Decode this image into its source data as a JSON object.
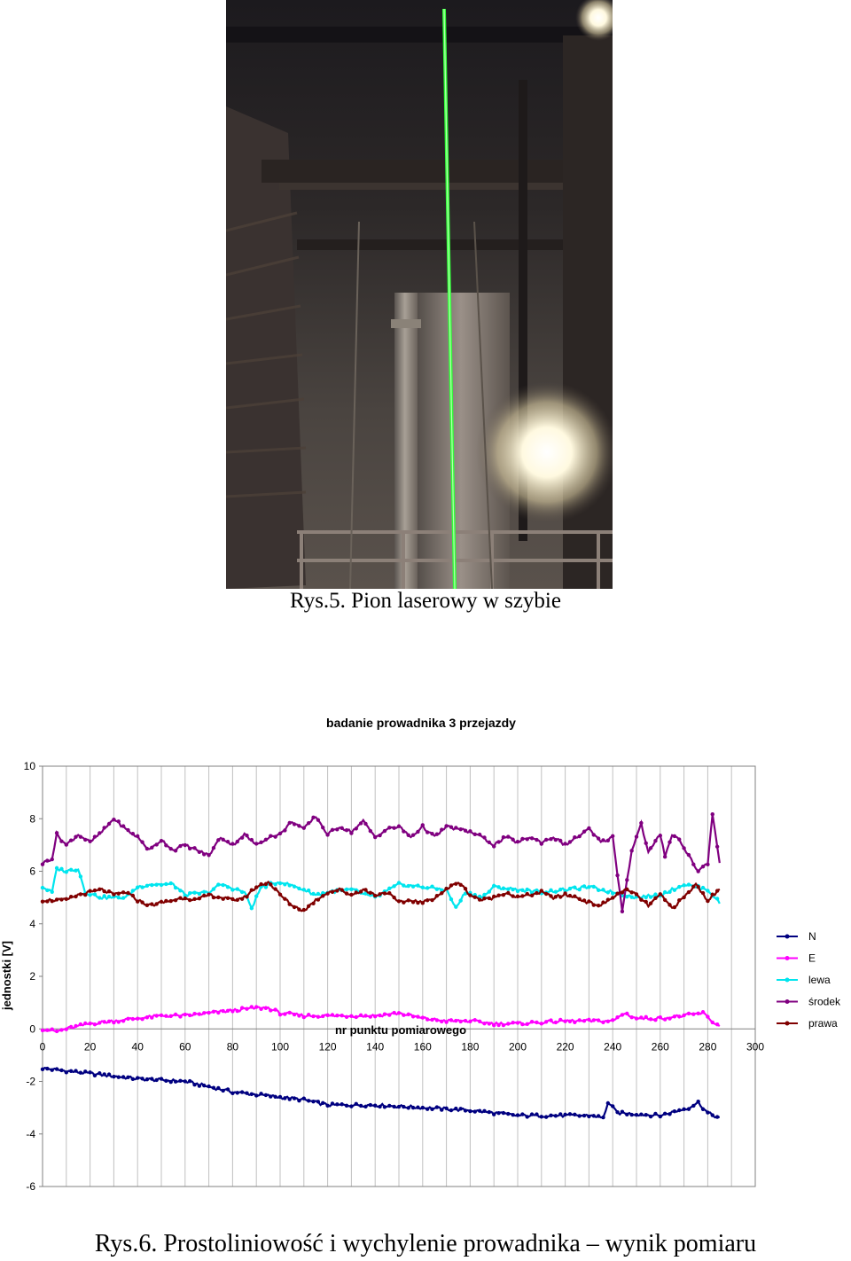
{
  "figure1": {
    "caption": "Rys.5. Pion laserowy w szybie",
    "image_description": "Dark mine shaft interior with a vertical green laser line"
  },
  "figure2": {
    "caption": "Rys.6. Prostoliniowość i wychylenie prowadnika – wynik pomiaru"
  },
  "colors": {
    "N": "#000080",
    "E": "#ff00ff",
    "lewa": "#00e5ee",
    "srodek": "#800080",
    "prawa": "#800000"
  },
  "chart_data": {
    "type": "line",
    "title": "badanie prowadnika 3 przejazdy",
    "xlabel": "nr punktu pomiarowego",
    "ylabel": "jednostki [V]",
    "xlim": [
      0,
      300
    ],
    "ylim": [
      -6,
      10
    ],
    "x_ticks": [
      0,
      20,
      40,
      60,
      80,
      100,
      120,
      140,
      160,
      180,
      200,
      220,
      240,
      260,
      280,
      300
    ],
    "y_ticks": [
      10,
      8,
      6,
      4,
      2,
      0,
      -2,
      -4,
      -6
    ],
    "grid": "vertical",
    "legend_position": "right",
    "x_points": [
      0,
      285
    ],
    "series": [
      {
        "name": "N",
        "key": "N",
        "anchors": [
          [
            0,
            -1.5
          ],
          [
            10,
            -1.6
          ],
          [
            20,
            -1.7
          ],
          [
            40,
            -1.9
          ],
          [
            60,
            -2.0
          ],
          [
            70,
            -2.2
          ],
          [
            80,
            -2.4
          ],
          [
            100,
            -2.6
          ],
          [
            110,
            -2.7
          ],
          [
            120,
            -2.9
          ],
          [
            140,
            -2.9
          ],
          [
            160,
            -3.0
          ],
          [
            180,
            -3.1
          ],
          [
            190,
            -3.2
          ],
          [
            200,
            -3.3
          ],
          [
            220,
            -3.3
          ],
          [
            232,
            -3.3
          ],
          [
            236,
            -3.4
          ],
          [
            238,
            -2.8
          ],
          [
            242,
            -3.2
          ],
          [
            260,
            -3.3
          ],
          [
            272,
            -3.0
          ],
          [
            276,
            -2.8
          ],
          [
            280,
            -3.2
          ],
          [
            285,
            -3.4
          ]
        ]
      },
      {
        "name": "E",
        "key": "E",
        "anchors": [
          [
            0,
            0.0
          ],
          [
            6,
            -0.1
          ],
          [
            10,
            0.0
          ],
          [
            20,
            0.2
          ],
          [
            30,
            0.3
          ],
          [
            40,
            0.4
          ],
          [
            50,
            0.5
          ],
          [
            60,
            0.5
          ],
          [
            70,
            0.6
          ],
          [
            80,
            0.7
          ],
          [
            90,
            0.8
          ],
          [
            95,
            0.8
          ],
          [
            100,
            0.6
          ],
          [
            110,
            0.5
          ],
          [
            120,
            0.5
          ],
          [
            140,
            0.5
          ],
          [
            150,
            0.6
          ],
          [
            160,
            0.4
          ],
          [
            170,
            0.3
          ],
          [
            180,
            0.3
          ],
          [
            190,
            0.2
          ],
          [
            200,
            0.2
          ],
          [
            220,
            0.3
          ],
          [
            240,
            0.3
          ],
          [
            245,
            0.6
          ],
          [
            250,
            0.4
          ],
          [
            260,
            0.4
          ],
          [
            270,
            0.5
          ],
          [
            278,
            0.6
          ],
          [
            283,
            0.2
          ],
          [
            285,
            0.1
          ]
        ]
      },
      {
        "name": "lewa",
        "key": "lewa",
        "anchors": [
          [
            0,
            5.4
          ],
          [
            4,
            5.2
          ],
          [
            6,
            6.1
          ],
          [
            10,
            6.0
          ],
          [
            15,
            6.1
          ],
          [
            18,
            5.2
          ],
          [
            25,
            5.0
          ],
          [
            35,
            5.0
          ],
          [
            40,
            5.4
          ],
          [
            45,
            5.5
          ],
          [
            55,
            5.5
          ],
          [
            60,
            5.1
          ],
          [
            70,
            5.2
          ],
          [
            75,
            5.5
          ],
          [
            85,
            5.2
          ],
          [
            88,
            4.6
          ],
          [
            92,
            5.4
          ],
          [
            100,
            5.6
          ],
          [
            110,
            5.3
          ],
          [
            115,
            5.1
          ],
          [
            120,
            5.2
          ],
          [
            130,
            5.3
          ],
          [
            140,
            5.0
          ],
          [
            150,
            5.5
          ],
          [
            160,
            5.4
          ],
          [
            170,
            5.3
          ],
          [
            174,
            4.6
          ],
          [
            178,
            5.2
          ],
          [
            185,
            5.0
          ],
          [
            190,
            5.4
          ],
          [
            200,
            5.3
          ],
          [
            210,
            5.2
          ],
          [
            220,
            5.3
          ],
          [
            230,
            5.4
          ],
          [
            240,
            5.2
          ],
          [
            250,
            5.0
          ],
          [
            260,
            5.1
          ],
          [
            270,
            5.5
          ],
          [
            280,
            5.3
          ],
          [
            285,
            4.8
          ]
        ]
      },
      {
        "name": "środek",
        "key": "srodek",
        "anchors": [
          [
            0,
            6.3
          ],
          [
            4,
            6.5
          ],
          [
            6,
            7.4
          ],
          [
            10,
            7.0
          ],
          [
            15,
            7.4
          ],
          [
            20,
            7.1
          ],
          [
            25,
            7.5
          ],
          [
            30,
            8.0
          ],
          [
            35,
            7.6
          ],
          [
            40,
            7.3
          ],
          [
            45,
            6.8
          ],
          [
            50,
            7.2
          ],
          [
            55,
            6.8
          ],
          [
            60,
            7.0
          ],
          [
            65,
            6.8
          ],
          [
            70,
            6.6
          ],
          [
            75,
            7.3
          ],
          [
            80,
            7.0
          ],
          [
            85,
            7.4
          ],
          [
            90,
            7.0
          ],
          [
            95,
            7.3
          ],
          [
            100,
            7.4
          ],
          [
            105,
            7.9
          ],
          [
            110,
            7.6
          ],
          [
            115,
            8.1
          ],
          [
            120,
            7.4
          ],
          [
            125,
            7.7
          ],
          [
            130,
            7.5
          ],
          [
            135,
            7.9
          ],
          [
            140,
            7.3
          ],
          [
            145,
            7.6
          ],
          [
            150,
            7.7
          ],
          [
            155,
            7.3
          ],
          [
            160,
            7.7
          ],
          [
            165,
            7.3
          ],
          [
            170,
            7.7
          ],
          [
            175,
            7.6
          ],
          [
            180,
            7.5
          ],
          [
            185,
            7.3
          ],
          [
            190,
            7.0
          ],
          [
            195,
            7.3
          ],
          [
            200,
            7.1
          ],
          [
            205,
            7.3
          ],
          [
            210,
            7.1
          ],
          [
            215,
            7.3
          ],
          [
            220,
            7.0
          ],
          [
            225,
            7.3
          ],
          [
            230,
            7.6
          ],
          [
            235,
            7.1
          ],
          [
            240,
            7.3
          ],
          [
            244,
            4.5
          ],
          [
            248,
            6.8
          ],
          [
            252,
            7.8
          ],
          [
            255,
            6.7
          ],
          [
            260,
            7.4
          ],
          [
            262,
            6.6
          ],
          [
            265,
            7.4
          ],
          [
            268,
            7.2
          ],
          [
            272,
            6.6
          ],
          [
            276,
            6.0
          ],
          [
            280,
            6.3
          ],
          [
            282,
            8.2
          ],
          [
            285,
            6.3
          ]
        ]
      },
      {
        "name": "prawa",
        "key": "prawa",
        "anchors": [
          [
            0,
            4.9
          ],
          [
            10,
            4.9
          ],
          [
            15,
            5.1
          ],
          [
            20,
            5.2
          ],
          [
            25,
            5.3
          ],
          [
            30,
            5.1
          ],
          [
            35,
            5.2
          ],
          [
            40,
            4.9
          ],
          [
            45,
            4.7
          ],
          [
            55,
            4.9
          ],
          [
            60,
            5.0
          ],
          [
            65,
            4.9
          ],
          [
            70,
            5.1
          ],
          [
            75,
            5.0
          ],
          [
            80,
            4.9
          ],
          [
            85,
            5.0
          ],
          [
            90,
            5.4
          ],
          [
            95,
            5.6
          ],
          [
            100,
            5.1
          ],
          [
            105,
            4.7
          ],
          [
            110,
            4.5
          ],
          [
            115,
            4.9
          ],
          [
            120,
            5.2
          ],
          [
            125,
            5.3
          ],
          [
            130,
            5.1
          ],
          [
            135,
            5.3
          ],
          [
            140,
            5.1
          ],
          [
            145,
            5.2
          ],
          [
            150,
            4.8
          ],
          [
            155,
            4.9
          ],
          [
            160,
            4.8
          ],
          [
            165,
            5.0
          ],
          [
            170,
            5.3
          ],
          [
            175,
            5.6
          ],
          [
            180,
            5.1
          ],
          [
            185,
            4.9
          ],
          [
            190,
            5.0
          ],
          [
            195,
            5.2
          ],
          [
            200,
            5.0
          ],
          [
            205,
            5.1
          ],
          [
            210,
            5.2
          ],
          [
            215,
            5.0
          ],
          [
            220,
            5.1
          ],
          [
            225,
            5.0
          ],
          [
            230,
            4.8
          ],
          [
            235,
            4.7
          ],
          [
            240,
            5.0
          ],
          [
            245,
            5.3
          ],
          [
            250,
            5.1
          ],
          [
            255,
            4.7
          ],
          [
            260,
            5.1
          ],
          [
            265,
            4.6
          ],
          [
            270,
            5.0
          ],
          [
            275,
            5.5
          ],
          [
            280,
            4.9
          ],
          [
            285,
            5.3
          ]
        ]
      }
    ]
  }
}
